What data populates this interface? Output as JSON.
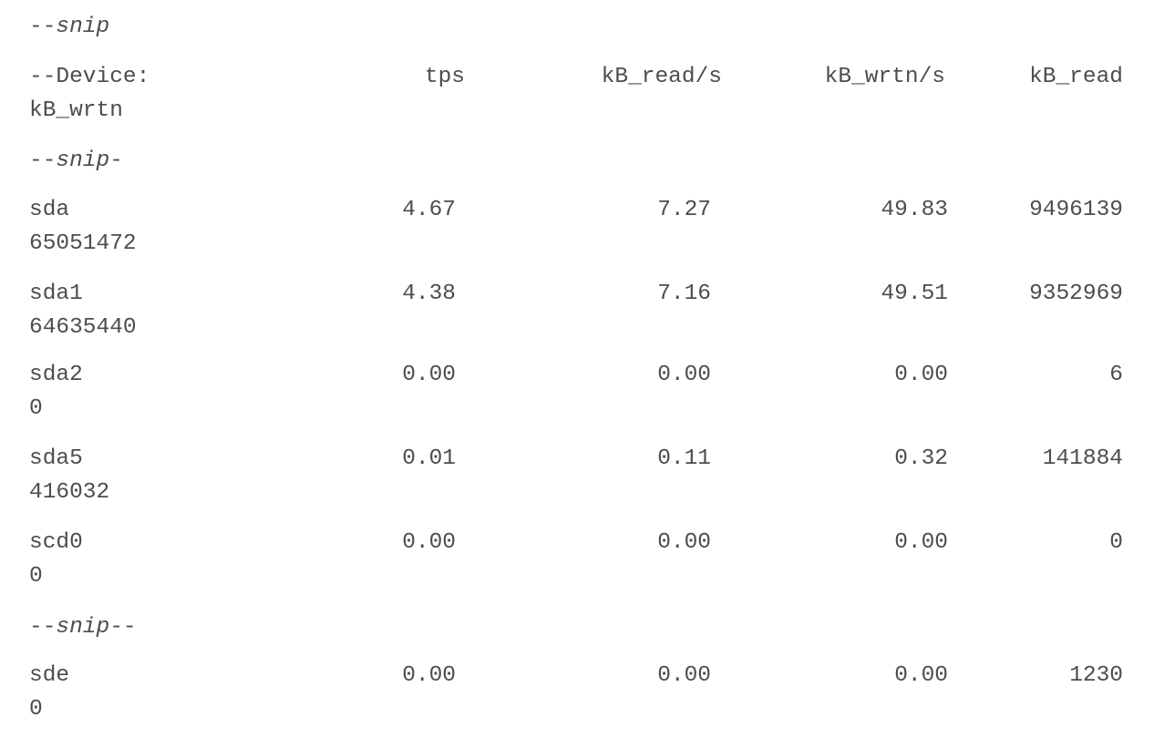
{
  "snip_markers": [
    {
      "dash_before": "--",
      "word": "snip",
      "dash_after": ""
    },
    {
      "dash_before": "--",
      "word": "snip",
      "dash_after": "-"
    },
    {
      "dash_before": "--",
      "word": "snip",
      "dash_after": "--"
    }
  ],
  "header": {
    "device": "--Device:",
    "tps": "tps",
    "kb_read_s": "kB_read/s",
    "kb_wrtn_s": "kB_wrtn/s",
    "kb_read": "kB_read",
    "kb_wrtn": "kB_wrtn"
  },
  "rows": [
    {
      "device": "sda",
      "tps": "4.67",
      "kb_read_s": "7.27",
      "kb_wrtn_s": "49.83",
      "kb_read": "9496139",
      "kb_wrtn": "65051472"
    },
    {
      "device": "sda1",
      "tps": "4.38",
      "kb_read_s": "7.16",
      "kb_wrtn_s": "49.51",
      "kb_read": "9352969",
      "kb_wrtn": "64635440"
    },
    {
      "device": "sda2",
      "tps": "0.00",
      "kb_read_s": "0.00",
      "kb_wrtn_s": "0.00",
      "kb_read": "6",
      "kb_wrtn": "0"
    },
    {
      "device": "sda5",
      "tps": "0.01",
      "kb_read_s": "0.11",
      "kb_wrtn_s": "0.32",
      "kb_read": "141884",
      "kb_wrtn": "416032"
    },
    {
      "device": "scd0",
      "tps": "0.00",
      "kb_read_s": "0.00",
      "kb_wrtn_s": "0.00",
      "kb_read": "0",
      "kb_wrtn": "0"
    },
    {
      "device": "sde",
      "tps": "0.00",
      "kb_read_s": "0.00",
      "kb_wrtn_s": "0.00",
      "kb_read": "1230",
      "kb_wrtn": "0"
    }
  ]
}
